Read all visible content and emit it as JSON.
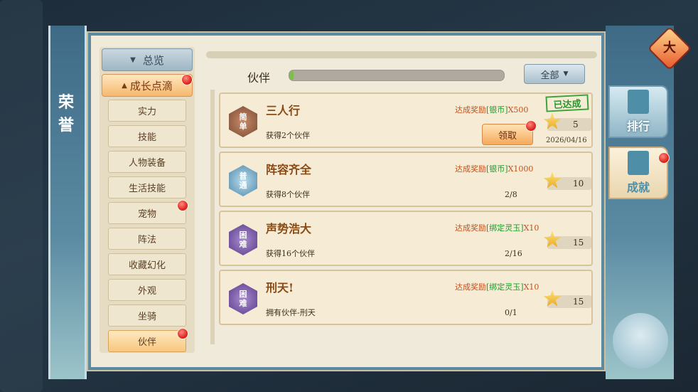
{
  "title": "荣誉",
  "sidebar": {
    "overview_label": "总览",
    "category_label": "成长点滴",
    "items": [
      {
        "label": "实力",
        "active": false,
        "dot": false
      },
      {
        "label": "技能",
        "active": false,
        "dot": false
      },
      {
        "label": "人物装备",
        "active": false,
        "dot": false
      },
      {
        "label": "生活技能",
        "active": false,
        "dot": false
      },
      {
        "label": "宠物",
        "active": false,
        "dot": true
      },
      {
        "label": "阵法",
        "active": false,
        "dot": false
      },
      {
        "label": "收藏幻化",
        "active": false,
        "dot": false
      },
      {
        "label": "外观",
        "active": false,
        "dot": false
      },
      {
        "label": "坐骑",
        "active": false,
        "dot": false
      },
      {
        "label": "伙伴",
        "active": true,
        "dot": true
      }
    ]
  },
  "content": {
    "section_label": "伙伴",
    "progress_fraction": 0.02,
    "filter_label": "全部"
  },
  "achievements": [
    {
      "badge_top": "简",
      "badge_bottom": "单",
      "difficulty": "easy",
      "title": "三人行",
      "desc": "获得2个伙伴",
      "reward_prefix": "达成奖励",
      "reward_item": "[银币]",
      "reward_qty": "X500",
      "points": "5",
      "stamp": "已达成",
      "claim": "领取",
      "date": "2026/04/16",
      "progress": ""
    },
    {
      "badge_top": "普",
      "badge_bottom": "通",
      "difficulty": "normal",
      "title": "阵容齐全",
      "desc": "获得8个伙伴",
      "reward_prefix": "达成奖励",
      "reward_item": "[银币]",
      "reward_qty": "X1000",
      "points": "10",
      "progress": "2/8"
    },
    {
      "badge_top": "困",
      "badge_bottom": "难",
      "difficulty": "hard",
      "title": "声势浩大",
      "desc": "获得16个伙伴",
      "reward_prefix": "达成奖励",
      "reward_item": "[绑定灵玉]",
      "reward_qty": "X10",
      "points": "15",
      "progress": "2/16"
    },
    {
      "badge_top": "困",
      "badge_bottom": "难",
      "difficulty": "hard",
      "title": "刑天!",
      "desc": "拥有伙伴-刑天",
      "reward_prefix": "达成奖励",
      "reward_item": "[绑定灵玉]",
      "reward_qty": "X10",
      "points": "15",
      "progress": "0/1"
    }
  ],
  "right_tabs": [
    {
      "label": "排行",
      "active": false
    },
    {
      "label": "成就",
      "active": true
    }
  ],
  "top_right_icon_glyph": "大"
}
